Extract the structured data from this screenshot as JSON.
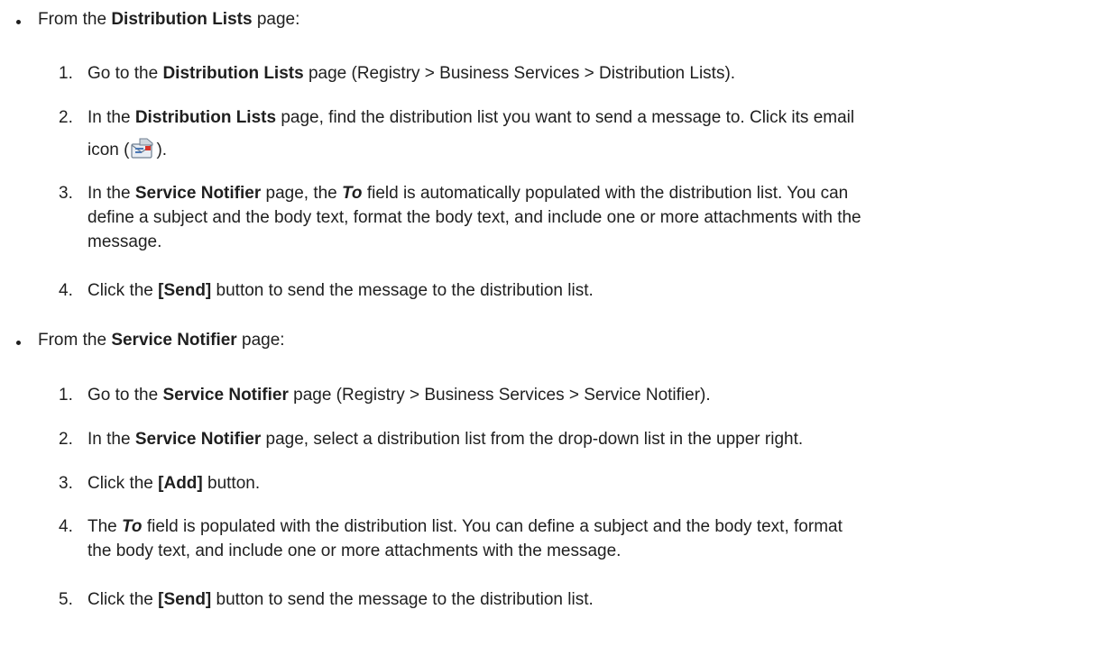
{
  "sections": [
    {
      "bullet": {
        "prefix": "From the ",
        "bold": "Distribution Lists",
        "suffix": " page:"
      },
      "steps": [
        {
          "num": "1.",
          "parts": [
            "Go to the ",
            "Distribution Lists",
            " page (Registry > Business Services > Distribution Lists)."
          ]
        },
        {
          "num": "2.",
          "parts": [
            "In the ",
            "Distribution Lists",
            " page, find the distribution list you want to send a message to. Click its email",
            "icon (",
            ")."
          ]
        },
        {
          "num": "3.",
          "parts": [
            "In the ",
            "Service Notifier",
            " page, the ",
            "To",
            " field is automatically populated with the distribution list. You can",
            "define a subject and the body text, format the body text, and include one or more attachments with the",
            "message."
          ]
        },
        {
          "num": "4.",
          "parts": [
            "Click the ",
            "[Send]",
            " button to send the message to the distribution list."
          ]
        }
      ]
    },
    {
      "bullet": {
        "prefix": "From the ",
        "bold": "Service Notifier",
        "suffix": " page:"
      },
      "steps": [
        {
          "num": "1.",
          "parts": [
            "Go to the ",
            "Service Notifier",
            " page (Registry > Business Services > Service Notifier)."
          ]
        },
        {
          "num": "2.",
          "parts": [
            "In the ",
            "Service Notifier",
            " page, select a distribution list from the drop-down list in the upper right."
          ]
        },
        {
          "num": "3.",
          "parts": [
            "Click the ",
            "[Add]",
            " button."
          ]
        },
        {
          "num": "4.",
          "parts": [
            "The ",
            "To",
            " field is populated with the distribution list. You can define a subject and the body text, format",
            "the body text, and include one or more attachments with the message."
          ]
        },
        {
          "num": "5.",
          "parts": [
            "Click the ",
            "[Send]",
            " button to send the message to the distribution list."
          ]
        }
      ]
    }
  ],
  "icons": {
    "email": "email-icon"
  }
}
